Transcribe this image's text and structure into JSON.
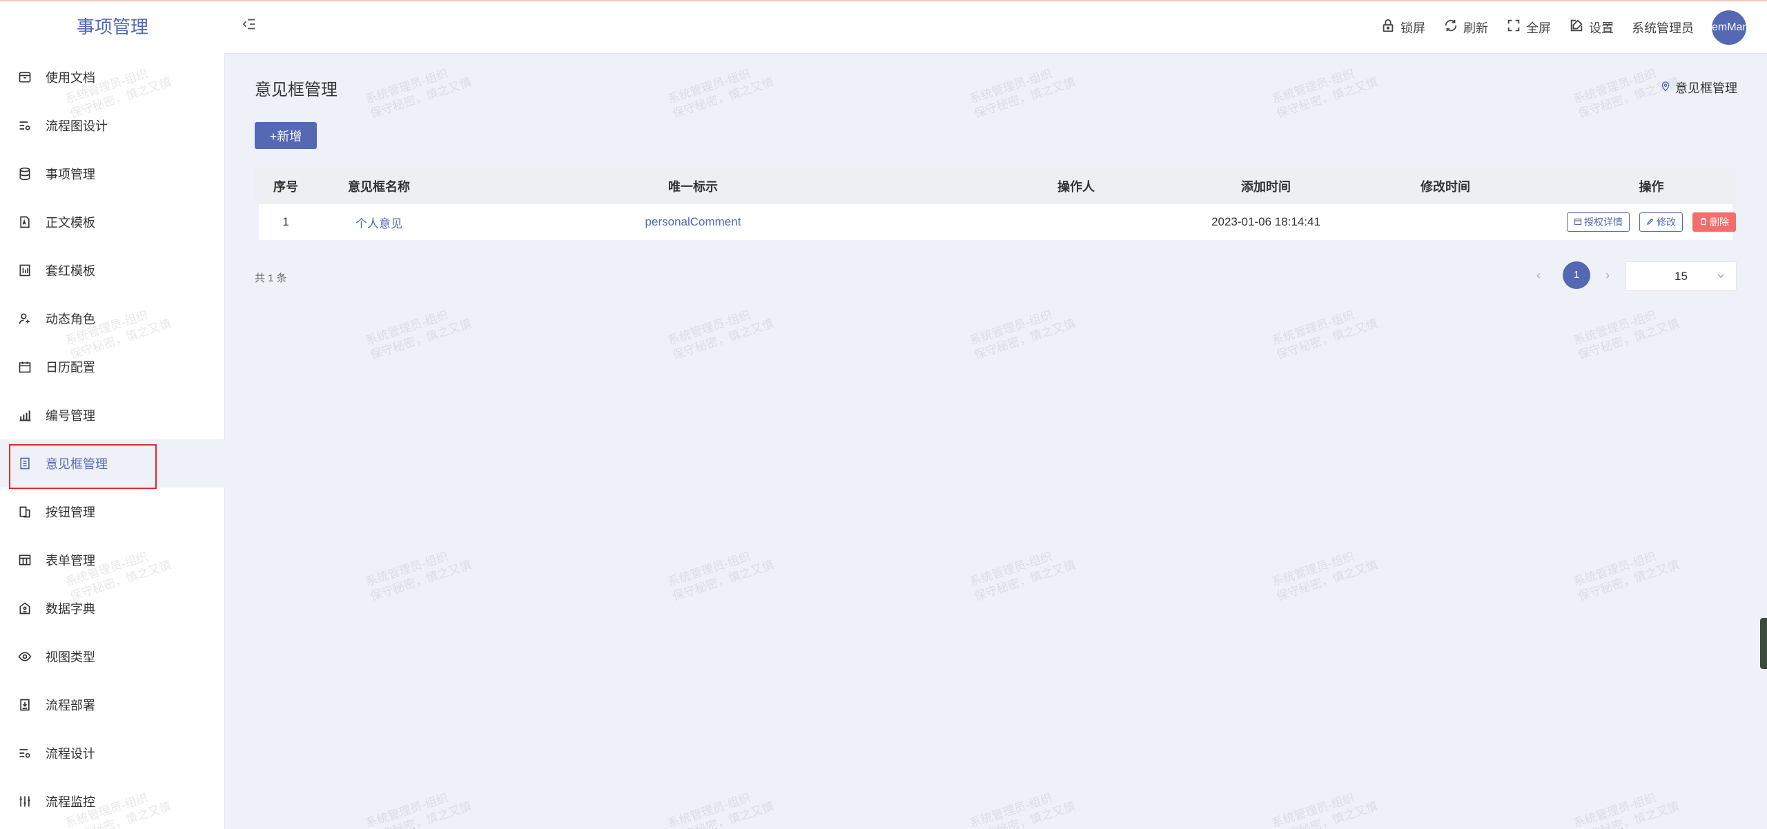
{
  "header": {
    "app_title": "事项管理",
    "actions": [
      {
        "label": "锁屏",
        "icon": "lock-icon"
      },
      {
        "label": "刷新",
        "icon": "refresh-icon"
      },
      {
        "label": "全屏",
        "icon": "fullscreen-icon"
      },
      {
        "label": "设置",
        "icon": "edit-settings-icon"
      }
    ],
    "user_name": "系统管理员",
    "avatar_text": "emMan"
  },
  "sidebar": {
    "items": [
      {
        "label": "使用文档",
        "icon": "archive-icon"
      },
      {
        "label": "流程图设计",
        "icon": "list-settings-icon"
      },
      {
        "label": "事项管理",
        "icon": "database-icon"
      },
      {
        "label": "正文模板",
        "icon": "document-icon"
      },
      {
        "label": "套红模板",
        "icon": "template-icon"
      },
      {
        "label": "动态角色",
        "icon": "user-add-icon"
      },
      {
        "label": "日历配置",
        "icon": "calendar-icon"
      },
      {
        "label": "编号管理",
        "icon": "bar-chart-icon"
      },
      {
        "label": "意见框管理",
        "icon": "form-icon"
      },
      {
        "label": "按钮管理",
        "icon": "copy-icon"
      },
      {
        "label": "表单管理",
        "icon": "table-icon"
      },
      {
        "label": "数据字典",
        "icon": "house-icon"
      },
      {
        "label": "视图类型",
        "icon": "eye-icon"
      },
      {
        "label": "流程部署",
        "icon": "deploy-icon"
      },
      {
        "label": "流程设计",
        "icon": "list-settings-icon"
      },
      {
        "label": "流程监控",
        "icon": "sliders-icon"
      }
    ],
    "active_index": 8
  },
  "main": {
    "title": "意见框管理",
    "breadcrumb": "意见框管理",
    "add_label": "+新增",
    "table": {
      "columns": [
        "序号",
        "意见框名称",
        "唯一标示",
        "操作人",
        "添加时间",
        "修改时间",
        "操作"
      ],
      "rows": [
        {
          "index": "1",
          "name": "个人意见",
          "key": "personalComment",
          "operator": "",
          "created": "2023-01-06 18:14:41",
          "modified": "",
          "actions": [
            "授权详情",
            "修改",
            "删除"
          ]
        }
      ]
    },
    "total": "共 1 条",
    "current_page": "1",
    "page_size": "15"
  },
  "watermark": "系统管理员-组织\n保守秘密，慎之又慎",
  "colors": {
    "accent": "#5468b4",
    "danger": "#f56c6c",
    "background": "#eef1f8"
  }
}
